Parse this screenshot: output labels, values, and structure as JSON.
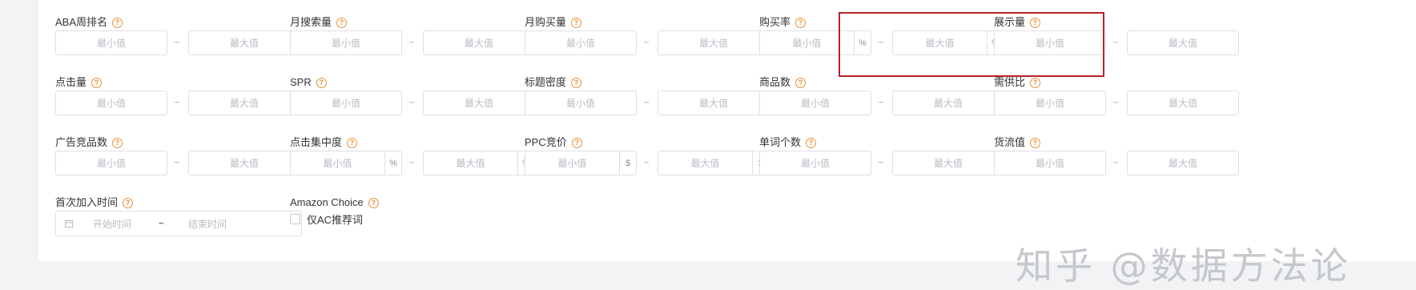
{
  "placeholders": {
    "min": "最小值",
    "max": "最大值"
  },
  "range_separator": "~",
  "fields": {
    "aba_rank": {
      "label": "ABA周排名",
      "help": "?"
    },
    "monthly_search": {
      "label": "月搜索量",
      "help": "?"
    },
    "monthly_purchase": {
      "label": "月购买量",
      "help": "?"
    },
    "purchase_rate": {
      "label": "购买率",
      "help": "?",
      "unit": "%"
    },
    "impressions": {
      "label": "展示量",
      "help": "?"
    },
    "clicks": {
      "label": "点击量",
      "help": "?"
    },
    "spr": {
      "label": "SPR",
      "help": "?"
    },
    "title_density": {
      "label": "标题密度",
      "help": "?"
    },
    "product_count": {
      "label": "商品数",
      "help": "?"
    },
    "supply_demand": {
      "label": "需供比",
      "help": "?"
    },
    "ad_products": {
      "label": "广告竞品数",
      "help": "?"
    },
    "click_concentration": {
      "label": "点击集中度",
      "help": "?",
      "unit": "%"
    },
    "ppc_bid": {
      "label": "PPC竞价",
      "help": "?",
      "unit": "$"
    },
    "word_count": {
      "label": "单词个数",
      "help": "?"
    },
    "cargo_value": {
      "label": "货流值",
      "help": "?"
    },
    "first_added": {
      "label": "首次加入时间",
      "help": "?",
      "start_placeholder": "开始时间",
      "end_placeholder": "结束时间",
      "separator": "~"
    },
    "amazon_choice": {
      "label": "Amazon Choice",
      "help": "?",
      "checkbox_label": "仅AC推荐词"
    }
  },
  "watermark": "知乎 @数据方法论",
  "colors": {
    "accent_help": "#e3923a",
    "highlight_border": "#b3242a",
    "border": "#dcdfe6"
  },
  "icons": {
    "help": "question-circle-icon",
    "calendar": "calendar-icon"
  }
}
